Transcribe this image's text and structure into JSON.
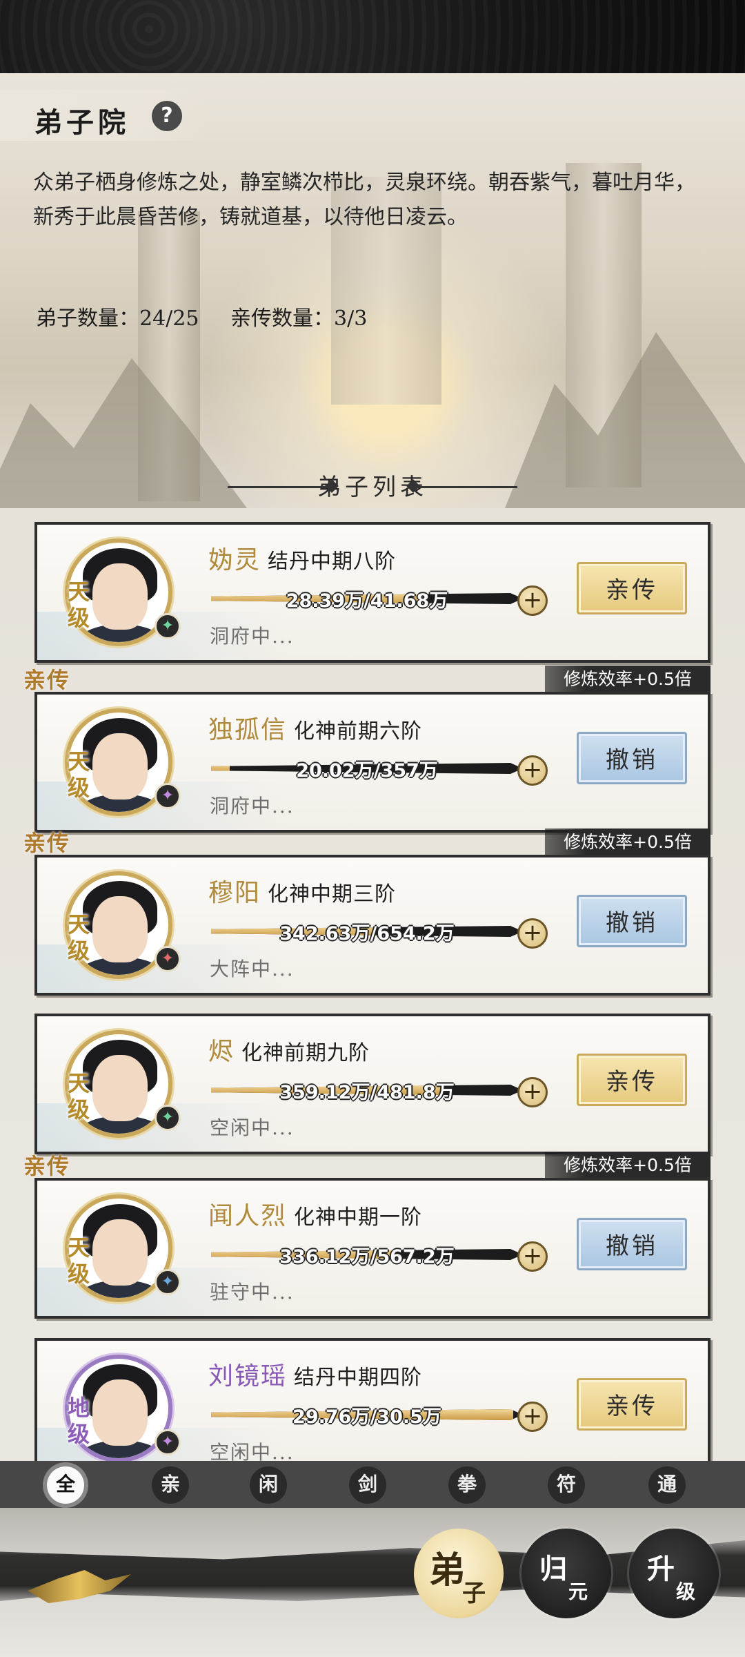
{
  "header": {
    "title": "弟子院",
    "help_icon": "question-icon",
    "description": "众弟子栖身修炼之处，静室鳞次栉比，灵泉环绕。朝吞紫气，暮吐月华，新秀于此晨昏苦修，铸就道基，以待他日凌云。",
    "disciple_count": "弟子数量：24/25",
    "inner_count": "亲传数量：3/3"
  },
  "list": {
    "title": "弟子列表",
    "ribbon_label": "亲传",
    "bonus_label": "修炼效率+0.5倍",
    "cards": [
      {
        "grade": "天级",
        "name": "妫灵",
        "realm": "结丹中期八阶",
        "progress_text": "28.39万/41.68万",
        "progress_fraction": 0.68,
        "status": "洞府中...",
        "action": "亲传",
        "inner": false,
        "element_icon": "wind-element-icon",
        "element_color": "#6fd49a"
      },
      {
        "grade": "天级",
        "name": "独孤信",
        "realm": "化神前期六阶",
        "progress_text": "20.02万/357万",
        "progress_fraction": 0.06,
        "status": "洞府中...",
        "action": "撤销",
        "inner": true,
        "element_icon": "water-element-icon",
        "element_color": "#c58ae0"
      },
      {
        "grade": "天级",
        "name": "穆阳",
        "realm": "化神中期三阶",
        "progress_text": "342.63万/654.2万",
        "progress_fraction": 0.52,
        "status": "大阵中...",
        "action": "撤销",
        "inner": true,
        "element_icon": "fire-element-icon",
        "element_color": "#e06b6b"
      },
      {
        "grade": "天级",
        "name": "烬",
        "realm": "化神前期九阶",
        "progress_text": "359.12万/481.8万",
        "progress_fraction": 0.74,
        "status": "空闲中...",
        "action": "亲传",
        "inner": false,
        "element_icon": "wind-element-icon",
        "element_color": "#6fd49a"
      },
      {
        "grade": "天级",
        "name": "闻人烈",
        "realm": "化神中期一阶",
        "progress_text": "336.12万/567.2万",
        "progress_fraction": 0.59,
        "status": "驻守中...",
        "action": "撤销",
        "inner": true,
        "element_icon": "sword-element-icon",
        "element_color": "#6aa8e0"
      },
      {
        "grade": "地级",
        "name": "刘镜瑶",
        "realm": "结丹中期四阶",
        "progress_text": "29.76万/30.5万",
        "progress_fraction": 0.97,
        "status": "空闲中...",
        "action": "亲传",
        "inner": false,
        "element_icon": "water-element-icon",
        "element_color": "#c58ae0"
      }
    ]
  },
  "filters": [
    "全",
    "亲",
    "闲",
    "剑",
    "拳",
    "符",
    "通"
  ],
  "nav": [
    {
      "big": "弟",
      "small": "子",
      "active": true
    },
    {
      "big": "归",
      "small": "元",
      "active": false
    },
    {
      "big": "升",
      "small": "级",
      "active": false
    }
  ]
}
